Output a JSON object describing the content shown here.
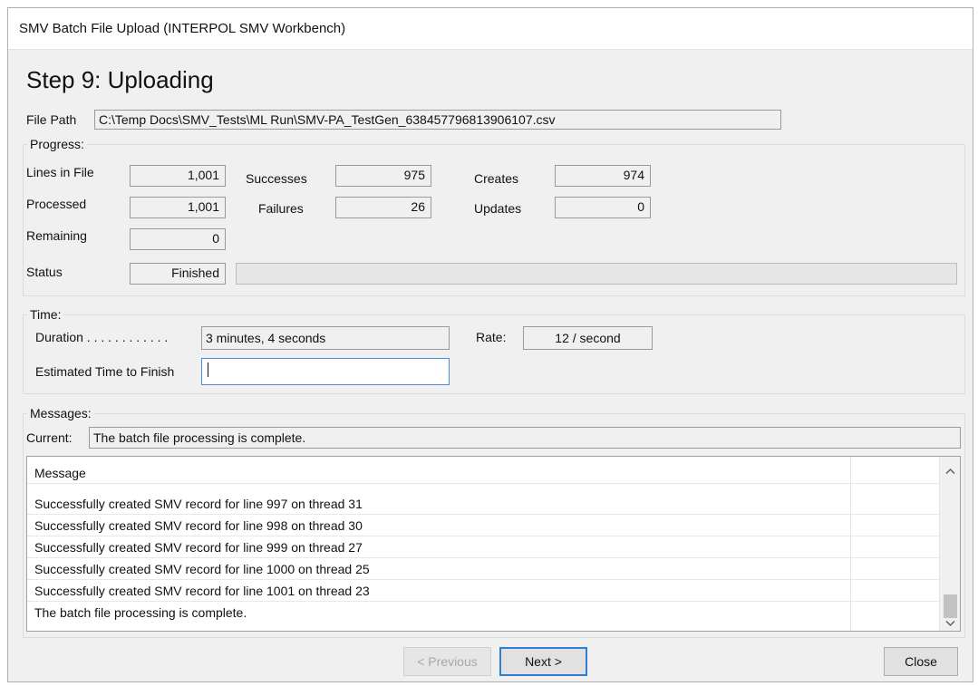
{
  "window": {
    "title": "SMV Batch File Upload (INTERPOL SMV Workbench)"
  },
  "step_title": "Step 9:  Uploading",
  "file_path": {
    "label": "File Path",
    "value": "C:\\Temp Docs\\SMV_Tests\\ML Run\\SMV-PA_TestGen_638457796813906107.csv"
  },
  "progress": {
    "group_label": "Progress:",
    "lines_in_file_label": "Lines in File",
    "lines_in_file": "1,001",
    "processed_label": "Processed",
    "processed": "1,001",
    "remaining_label": "Remaining",
    "remaining": "0",
    "successes_label": "Successes",
    "successes": "975",
    "failures_label": "Failures",
    "failures": "26",
    "creates_label": "Creates",
    "creates": "974",
    "updates_label": "Updates",
    "updates": "0",
    "status_label": "Status",
    "status": "Finished",
    "bar_fraction": 0
  },
  "time": {
    "group_label": "Time:",
    "duration_label": "Duration . . . . . . . . . . . .",
    "duration": "3 minutes, 4 seconds",
    "rate_label": "Rate:",
    "rate": "12 / second",
    "eta_label": "Estimated Time to Finish",
    "eta": ""
  },
  "messages": {
    "group_label": "Messages:",
    "current_label": "Current:",
    "current": "The batch file processing is complete.",
    "column_header": "Message",
    "rows": [
      "Successfully created SMV record for line 997 on thread 31",
      "Successfully created SMV record for line 998 on thread 30",
      "Successfully created SMV record for line 999 on thread 27",
      "Successfully created SMV record for line 1000 on thread 25",
      "Successfully created SMV record for line 1001 on thread 23",
      "The batch file processing is complete."
    ]
  },
  "buttons": {
    "previous": "< Previous",
    "next": "Next >",
    "close": "Close"
  },
  "icons": {
    "scroll_up": "chevron-up-icon",
    "scroll_down": "chevron-down-icon"
  }
}
